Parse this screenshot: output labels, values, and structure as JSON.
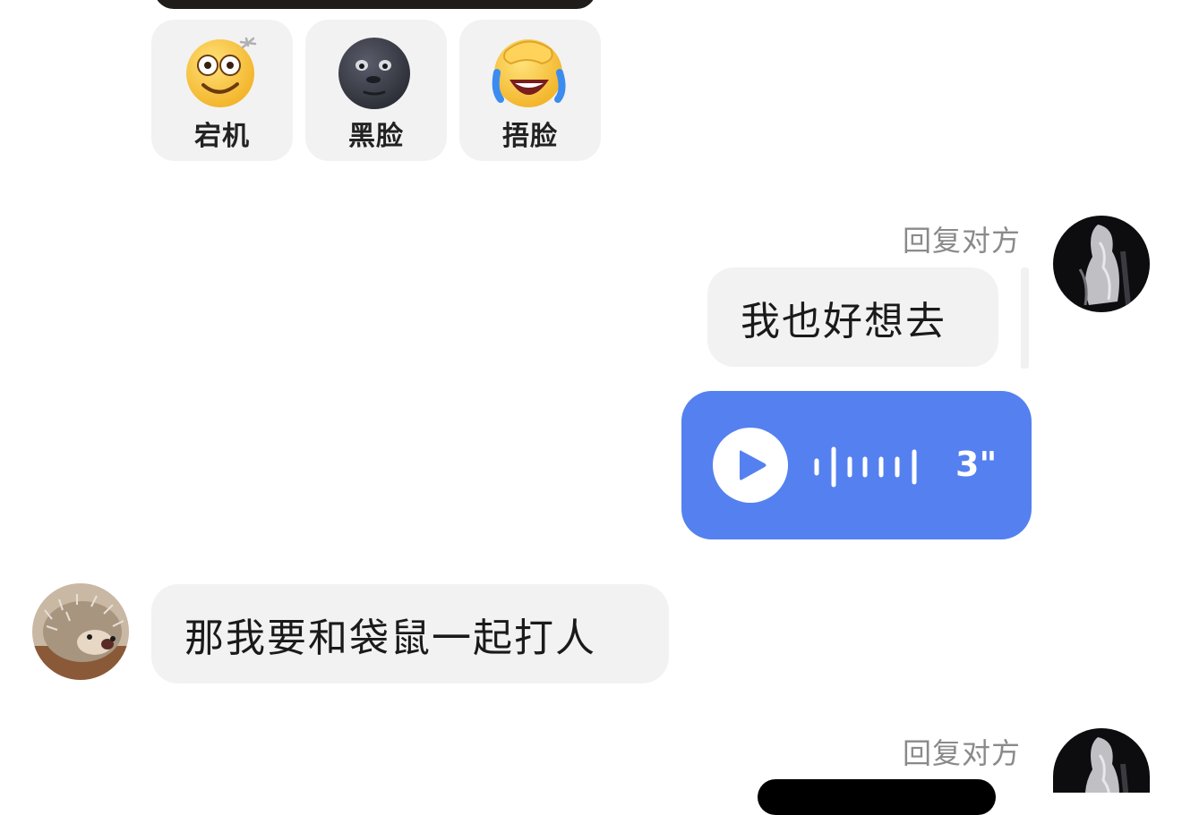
{
  "stickers": [
    {
      "icon": "dizzy-face-icon",
      "label": "宕机"
    },
    {
      "icon": "black-face-icon",
      "label": "黑脸"
    },
    {
      "icon": "facepalm-laugh-icon",
      "label": "捂脸"
    }
  ],
  "messages": [
    {
      "side": "right",
      "reply_label": "回复对方",
      "text": "我也好想去"
    },
    {
      "side": "right",
      "type": "voice",
      "duration": "3\""
    },
    {
      "side": "left",
      "text": "那我要和袋鼠一起打人"
    },
    {
      "side": "right",
      "reply_label": "回复对方"
    }
  ],
  "colors": {
    "voice_bubble": "#5580f0",
    "gray_bubble": "#f2f2f2",
    "reply_label": "#8a8a8a"
  }
}
